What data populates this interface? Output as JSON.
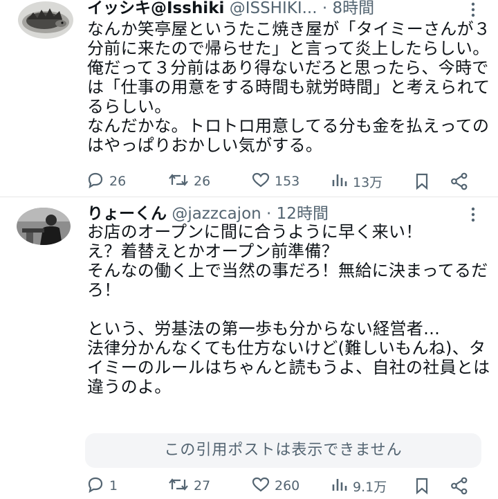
{
  "posts": [
    {
      "author_name": "イッシキ@Isshiki",
      "handle": "@ISSHIKI...",
      "separator": "·",
      "time": "8時間",
      "text": "なんか笑亭屋というたこ焼き屋が「タイミーさんが３分前に来たので帰らせた」と言って炎上したらしい。\n俺だって３分前はあり得ないだろと思ったら、今時では「仕事の用意をする時間も就労時間」と考えられてるらしい。\nなんだかな。トロトロ用意してる分も金を払えってのはやっぱりおかしい気がする。",
      "replies": "26",
      "reposts": "26",
      "likes": "153",
      "views": "13万",
      "icons": [
        "more-icon",
        "reply-icon",
        "repost-icon",
        "like-icon",
        "views-icon",
        "bookmark-icon",
        "share-icon"
      ]
    },
    {
      "author_name": "りょーくん",
      "handle": "@jazzcajon",
      "separator": "·",
      "time": "12時間",
      "text": "お店のオープンに間に合うように早く来い！\nえ？着替えとかオープン前準備？\nそんなの働く上で当然の事だろ！無給に決まってるだろ！\n\nという、労基法の第一歩も分からない経営者…\n法律分かんなくても仕方ないけど(難しいもんね)、タイミーのルールはちゃんと読もうよ、自社の社員とは違うのよ。",
      "quote_text": "この引用ポストは表示できません",
      "replies": "1",
      "reposts": "27",
      "likes": "260",
      "views": "9.1万",
      "icons": [
        "more-icon",
        "reply-icon",
        "repost-icon",
        "like-icon",
        "views-icon",
        "bookmark-icon",
        "share-icon"
      ]
    }
  ],
  "colors": {
    "text": "#0f1419",
    "secondary": "#536471",
    "quote_bg": "#f4f5f7",
    "divider": "#e6e6e6"
  }
}
